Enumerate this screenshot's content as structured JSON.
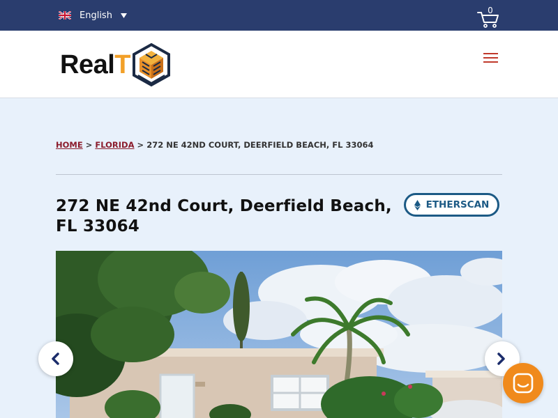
{
  "topbar": {
    "language": "English",
    "cart_count": "0"
  },
  "header": {
    "logo_text_a": "Real",
    "logo_text_b": "T"
  },
  "breadcrumb": {
    "home": "HOME",
    "sep": ">",
    "state": "FLORIDA",
    "current": "272 NE 42ND COURT, DEERFIELD BEACH, FL 33064"
  },
  "property": {
    "title": "272 NE 42nd Court, Deerfield Beach, FL 33064",
    "etherscan_label": "ETHERSCAN"
  },
  "colors": {
    "topbar": "#2a3d6e",
    "accent_red": "#8b1c2c",
    "etherscan_blue": "#1c5a85",
    "logo_orange": "#f2a029",
    "chat_orange": "#f08a1c"
  },
  "icons": [
    "flag-uk-icon",
    "caret-down-icon",
    "cart-icon",
    "hamburger-menu-icon",
    "ethereum-icon",
    "chevron-left-icon",
    "chevron-right-icon",
    "chat-icon"
  ]
}
